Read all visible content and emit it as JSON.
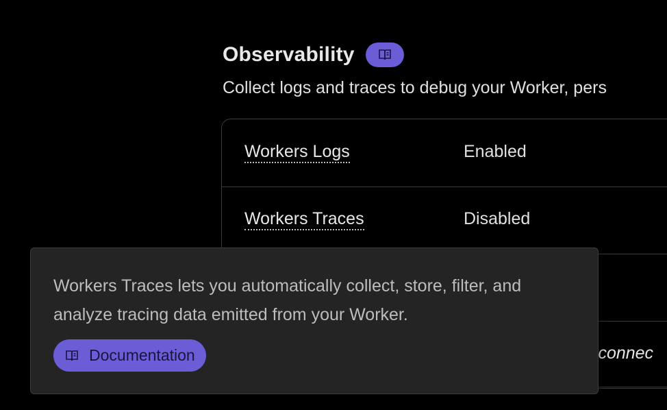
{
  "section": {
    "title": "Observability",
    "description": "Collect logs and traces to debug your Worker, pers",
    "doc_icon": "book-icon"
  },
  "settings": {
    "rows": [
      {
        "label": "Workers Logs",
        "value": "Enabled"
      },
      {
        "label": "Workers Traces",
        "value": "Disabled"
      },
      {
        "label": "",
        "value": ""
      },
      {
        "label": "",
        "value": "s connec"
      }
    ]
  },
  "tooltip": {
    "text": "Workers Traces lets you automatically collect, store, filter, and analyze tracing data emitted from your Worker.",
    "button_label": "Documentation",
    "button_icon": "book-icon"
  },
  "colors": {
    "accent": "#6a5dd6",
    "background": "#000000",
    "tooltip_bg": "#242424"
  }
}
